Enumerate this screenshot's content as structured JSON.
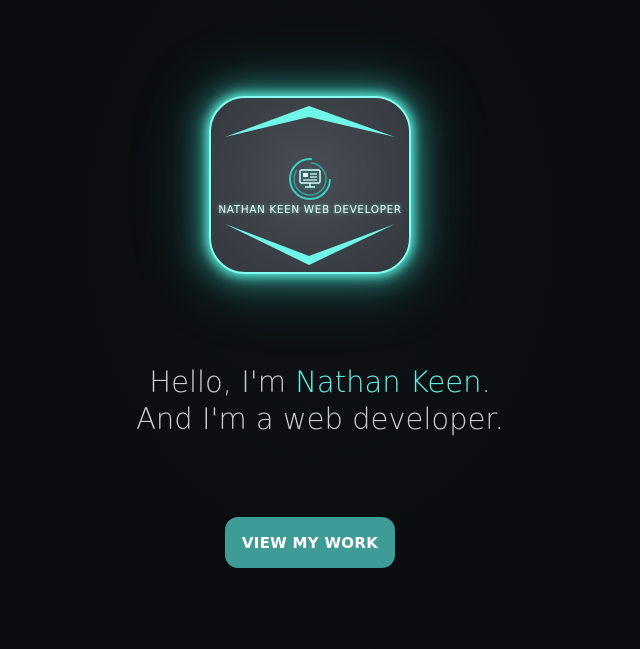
{
  "logo": {
    "text": "NATHAN KEEN WEB DEVELOPER",
    "icon": "monitor-circuit-icon",
    "glow_color": "#5effec",
    "card_color": "#3c4047"
  },
  "intro": {
    "line1_prefix": "Hello, I'm ",
    "name": "Nathan Keen",
    "line1_suffix": ".",
    "line2": "And I'm a web developer."
  },
  "cta": {
    "label": "VIEW MY WORK",
    "color": "#3f9b96"
  },
  "colors": {
    "background": "#0b0d10",
    "accent": "#5ff2e4",
    "text": "#c9cccf"
  }
}
